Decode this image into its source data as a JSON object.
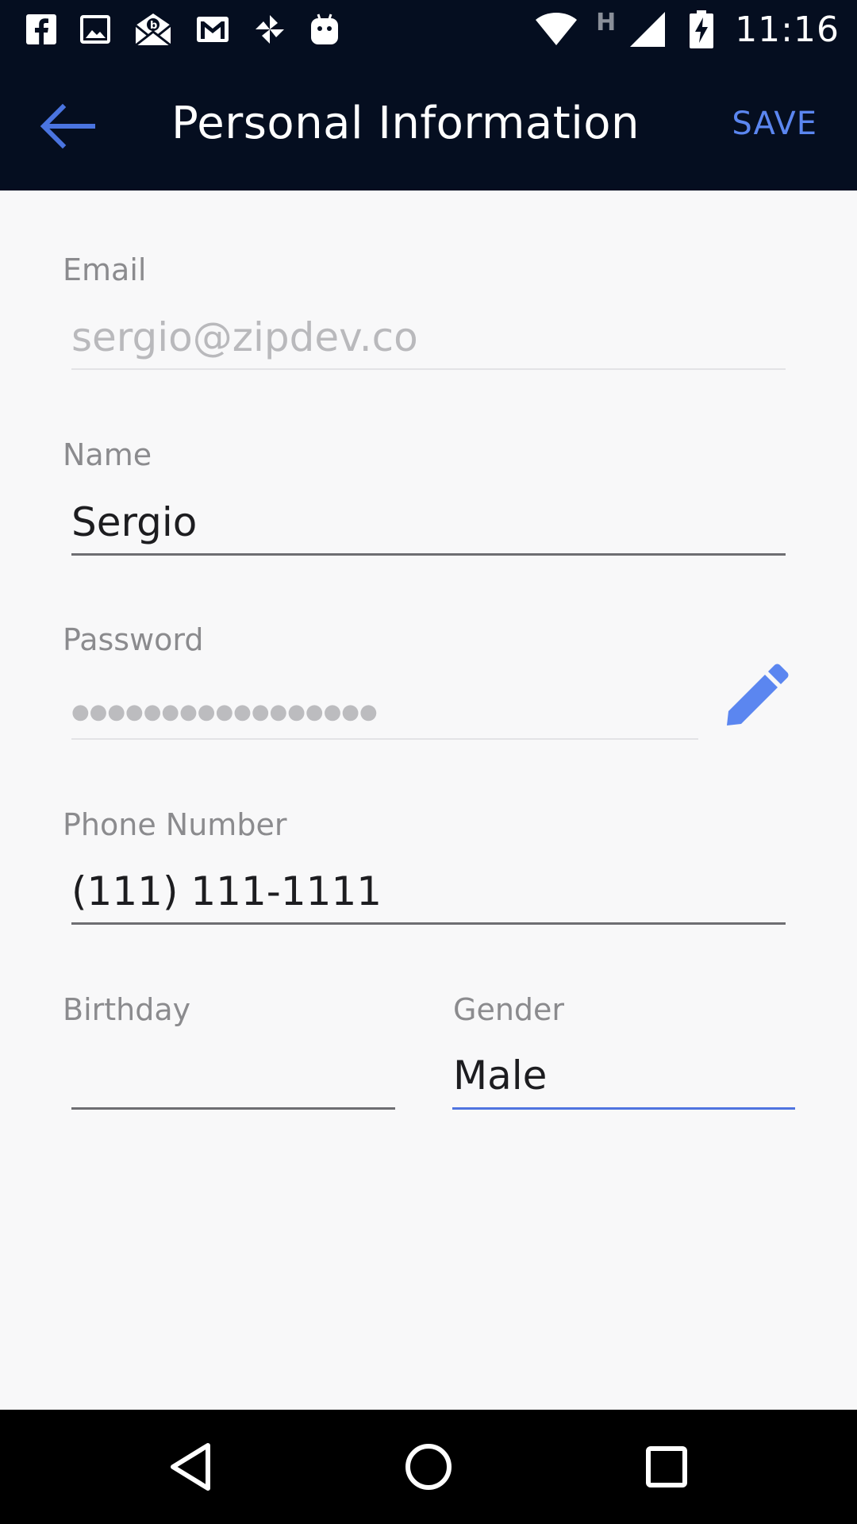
{
  "status_bar": {
    "time": "11:16",
    "network_type": "H",
    "left_icons": [
      "facebook-icon",
      "gallery-icon",
      "mail-open-icon",
      "gmail-icon",
      "pinwheel-icon",
      "android-icon"
    ],
    "right_icons": [
      "wifi-icon",
      "signal-icon",
      "battery-charging-icon"
    ]
  },
  "toolbar": {
    "title": "Personal Information",
    "save_label": "SAVE",
    "back_icon": "arrow-back-icon",
    "accent_color": "#5b86f0"
  },
  "form": {
    "email": {
      "label": "Email",
      "value": "sergio@zipdev.co"
    },
    "name": {
      "label": "Name",
      "value": "Sergio"
    },
    "password": {
      "label": "Password",
      "masked_value": "●●●●●●●●●●●●●●●●●",
      "edit_icon": "pencil-icon"
    },
    "phone": {
      "label": "Phone Number",
      "value": "(111) 111-1111"
    },
    "birthday": {
      "label": "Birthday",
      "value": ""
    },
    "gender": {
      "label": "Gender",
      "value": "Male"
    }
  },
  "nav_bar": {
    "buttons": [
      "back-triangle-icon",
      "home-circle-icon",
      "recents-square-icon"
    ]
  },
  "colors": {
    "header_bg": "#050e20",
    "accent": "#5b86f0",
    "page_bg": "#f8f8f9"
  }
}
